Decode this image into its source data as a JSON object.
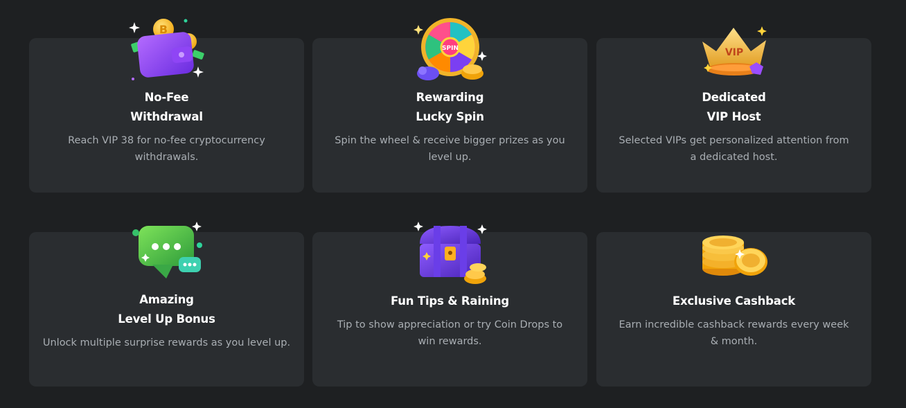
{
  "cards": [
    {
      "icon": "wallet-icon",
      "title_line1": "No-Fee",
      "title_line2": "Withdrawal",
      "description": "Reach VIP 38 for no-fee cryptocurrency withdrawals."
    },
    {
      "icon": "spin-wheel-icon",
      "wheel_label": "SPIN",
      "title_line1": "Rewarding",
      "title_line2": "Lucky Spin",
      "description": "Spin the wheel & receive bigger prizes as you level up."
    },
    {
      "icon": "vip-crown-icon",
      "crown_label": "VIP",
      "title_line1": "Dedicated",
      "title_line2": "VIP Host",
      "description": "Selected VIPs get personalized attention from a dedicated host."
    },
    {
      "icon": "chat-bubble-icon",
      "title_line1": "Amazing",
      "title_line2": "Level Up Bonus",
      "description": "Unlock multiple surprise rewards as you level up."
    },
    {
      "icon": "treasure-chest-icon",
      "title_line1": "Fun Tips & Raining",
      "description": "Tip to show appreciation or try Coin Drops to win rewards."
    },
    {
      "icon": "coin-stack-icon",
      "title_line1": "Exclusive Cashback",
      "description": "Earn incredible cashback rewards every week & month."
    }
  ],
  "colors": {
    "background": "#1e2022",
    "card": "#2a2d30",
    "title": "#ffffff",
    "description": "#a9aeb3"
  }
}
